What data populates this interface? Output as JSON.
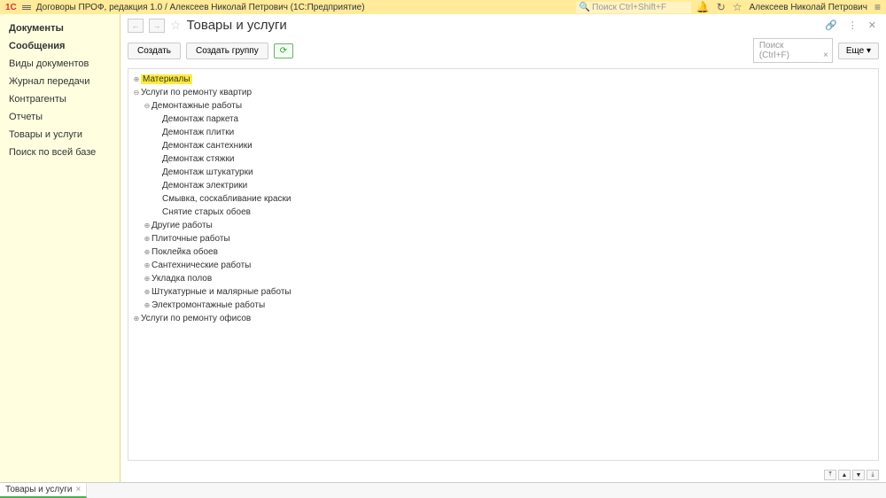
{
  "topbar": {
    "logo": "1C",
    "title": "Договоры ПРОФ, редакция 1.0 / Алексеев Николай Петрович  (1С:Предприятие)",
    "searchPlaceholder": "Поиск Ctrl+Shift+F",
    "user": "Алексеев Николай Петрович"
  },
  "sidebar": {
    "items": [
      {
        "label": "Документы",
        "bold": true
      },
      {
        "label": "Сообщения",
        "bold": true
      },
      {
        "label": "Виды документов",
        "bold": false
      },
      {
        "label": "Журнал передачи",
        "bold": false
      },
      {
        "label": "Контрагенты",
        "bold": false
      },
      {
        "label": "Отчеты",
        "bold": false
      },
      {
        "label": "Товары и услуги",
        "bold": false
      },
      {
        "label": "Поиск по всей базе",
        "bold": false
      }
    ]
  },
  "page": {
    "title": "Товары и услуги"
  },
  "toolbar": {
    "create": "Создать",
    "createGroup": "Создать группу",
    "searchPlaceholder": "Поиск (Ctrl+F)",
    "more": "Еще"
  },
  "tree": [
    {
      "level": 0,
      "exp": "⊕",
      "label": "Материалы",
      "highlight": true
    },
    {
      "level": 0,
      "exp": "⊖",
      "label": "Услуги по ремонту квартир"
    },
    {
      "level": 1,
      "exp": "⊖",
      "label": "Демонтажные работы"
    },
    {
      "level": 2,
      "exp": "",
      "label": "Демонтаж паркета"
    },
    {
      "level": 2,
      "exp": "",
      "label": "Демонтаж плитки"
    },
    {
      "level": 2,
      "exp": "",
      "label": "Демонтаж сантехники"
    },
    {
      "level": 2,
      "exp": "",
      "label": "Демонтаж стяжки"
    },
    {
      "level": 2,
      "exp": "",
      "label": "Демонтаж штукатурки"
    },
    {
      "level": 2,
      "exp": "",
      "label": "Демонтаж электрики"
    },
    {
      "level": 2,
      "exp": "",
      "label": "Смывка, соскабливание краски"
    },
    {
      "level": 2,
      "exp": "",
      "label": "Снятие старых обоев"
    },
    {
      "level": 1,
      "exp": "⊕",
      "label": "Другие работы"
    },
    {
      "level": 1,
      "exp": "⊕",
      "label": "Плиточные работы"
    },
    {
      "level": 1,
      "exp": "⊕",
      "label": "Поклейка обоев"
    },
    {
      "level": 1,
      "exp": "⊕",
      "label": "Сантехнические работы"
    },
    {
      "level": 1,
      "exp": "⊕",
      "label": "Укладка полов"
    },
    {
      "level": 1,
      "exp": "⊕",
      "label": "Штукатурные и малярные работы"
    },
    {
      "level": 1,
      "exp": "⊕",
      "label": "Электромонтажные работы"
    },
    {
      "level": 0,
      "exp": "⊕",
      "label": "Услуги по ремонту офисов"
    }
  ],
  "tab": {
    "label": "Товары и услуги"
  }
}
